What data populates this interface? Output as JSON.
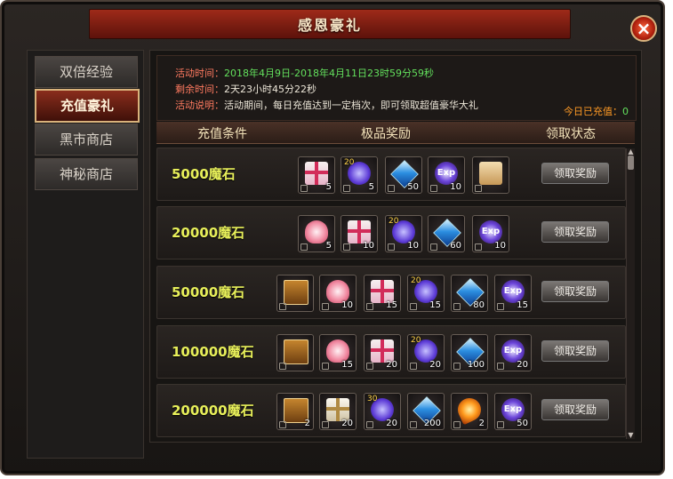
{
  "window": {
    "title": "感恩豪礼",
    "close_icon": "×"
  },
  "sidebar": {
    "tabs": [
      {
        "label": "双倍经验",
        "active": false
      },
      {
        "label": "充值豪礼",
        "active": true
      },
      {
        "label": "黑市商店",
        "active": false
      },
      {
        "label": "神秘商店",
        "active": false
      }
    ]
  },
  "info": {
    "time_label": "活动时间：",
    "time_value": "2018年4月9日-2018年4月11日23时59分59秒",
    "remain_label": "剩余时间：",
    "remain_value": "2天23小时45分22秒",
    "desc_label": "活动说明：",
    "desc_value": "活动期间，每日充值达到一定档次，即可领取超值豪华大礼",
    "charged_label": "今日已充值：",
    "charged_value": "0"
  },
  "columns": {
    "condition": "充值条件",
    "reward": "极品奖励",
    "status": "领取状态"
  },
  "rows": [
    {
      "condition": "5000魔石",
      "button": "领取奖励",
      "items": [
        {
          "icon": "gift-box-icon",
          "count": "5"
        },
        {
          "icon": "spirit-orb-icon",
          "count": "5",
          "tag": "20"
        },
        {
          "icon": "blue-crystal-icon",
          "count": "50"
        },
        {
          "icon": "exp-orb-icon",
          "count": "10",
          "text": "Exp"
        },
        {
          "icon": "scroll-icon",
          "count": ""
        }
      ]
    },
    {
      "condition": "20000魔石",
      "button": "领取奖励",
      "items": [
        {
          "icon": "lotus-icon",
          "count": "5"
        },
        {
          "icon": "gift-box-icon",
          "count": "10"
        },
        {
          "icon": "spirit-orb-icon",
          "count": "10",
          "tag": "20"
        },
        {
          "icon": "blue-crystal-icon",
          "count": "60"
        },
        {
          "icon": "exp-orb-icon",
          "count": "10",
          "text": "Exp"
        }
      ]
    },
    {
      "condition": "50000魔石",
      "button": "领取奖励",
      "items": [
        {
          "icon": "treasure-chest-icon",
          "count": ""
        },
        {
          "icon": "lotus-icon",
          "count": "10"
        },
        {
          "icon": "gift-box-icon",
          "count": "15"
        },
        {
          "icon": "spirit-orb-icon",
          "count": "15",
          "tag": "20"
        },
        {
          "icon": "blue-crystal-icon",
          "count": "80"
        },
        {
          "icon": "exp-orb-icon",
          "count": "15",
          "text": "Exp"
        }
      ]
    },
    {
      "condition": "100000魔石",
      "button": "领取奖励",
      "items": [
        {
          "icon": "treasure-chest-icon",
          "count": ""
        },
        {
          "icon": "lotus-icon",
          "count": "15"
        },
        {
          "icon": "gift-box-icon",
          "count": "20"
        },
        {
          "icon": "spirit-orb-icon",
          "count": "20",
          "tag": "20"
        },
        {
          "icon": "blue-crystal-icon",
          "count": "100"
        },
        {
          "icon": "exp-orb-icon",
          "count": "20",
          "text": "Exp"
        }
      ]
    },
    {
      "condition": "200000魔石",
      "button": "领取奖励",
      "items": [
        {
          "icon": "treasure-chest-icon",
          "count": "2"
        },
        {
          "icon": "white-gift-icon",
          "count": "20"
        },
        {
          "icon": "spirit-orb-icon",
          "count": "20",
          "tag": "30"
        },
        {
          "icon": "blue-crystal-icon",
          "count": "200"
        },
        {
          "icon": "fire-gem-icon",
          "count": "2"
        },
        {
          "icon": "exp-orb-icon",
          "count": "50",
          "text": "Exp"
        }
      ]
    }
  ],
  "colors": {
    "accent_red": "#8a2d1c",
    "condition_yellow": "#e8f05a",
    "info_green": "#63e05d",
    "charged_orange": "#ff9a25"
  }
}
